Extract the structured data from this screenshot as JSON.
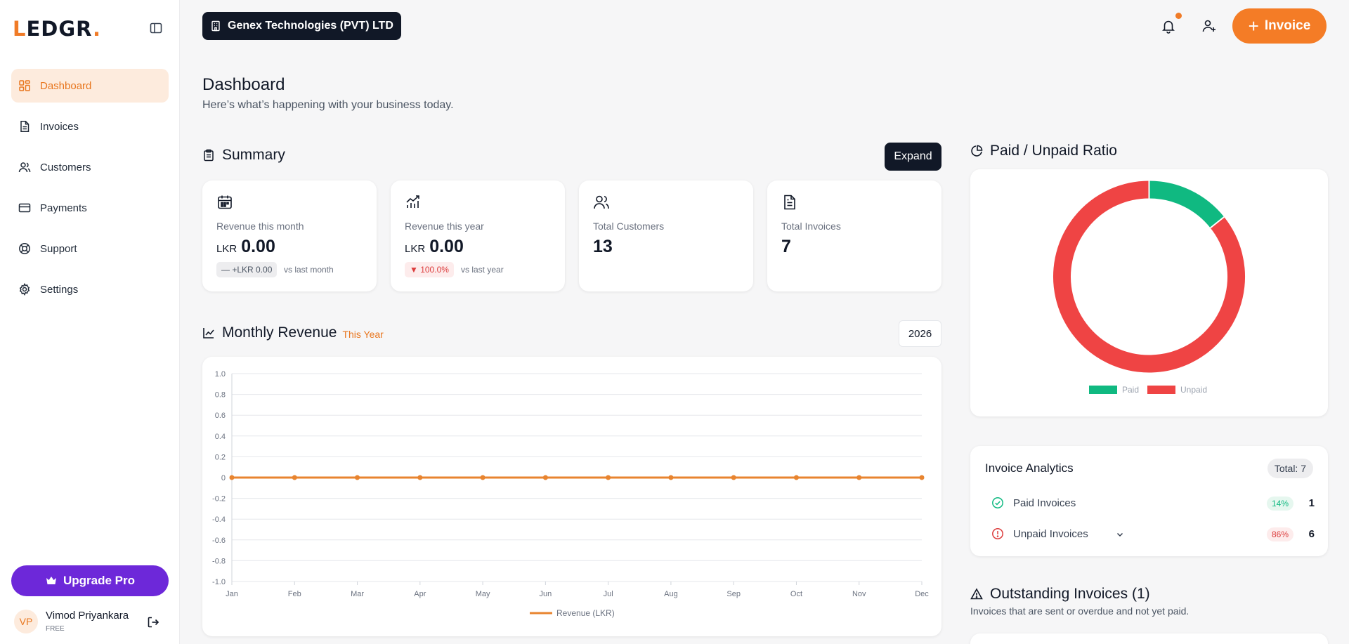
{
  "app": {
    "logo": "LEDGR.",
    "logo_first": "L",
    "logo_mid": "EDGR",
    "logo_dot": "."
  },
  "sidebar": {
    "items": [
      {
        "label": "Dashboard",
        "icon": "dashboard-icon",
        "active": true
      },
      {
        "label": "Invoices",
        "icon": "file-text-icon"
      },
      {
        "label": "Customers",
        "icon": "users-icon"
      },
      {
        "label": "Payments",
        "icon": "credit-card-icon"
      },
      {
        "label": "Support",
        "icon": "life-buoy-icon"
      },
      {
        "label": "Settings",
        "icon": "gear-icon"
      }
    ],
    "upgrade_label": "Upgrade Pro",
    "user": {
      "initials": "VP",
      "name": "Vimod Priyankara",
      "plan": "FREE"
    }
  },
  "header": {
    "company": "Genex Technologies (PVT) LTD",
    "new_invoice_label": "Invoice",
    "new_invoice_plus": "+"
  },
  "page": {
    "title": "Dashboard",
    "subtitle": "Here’s what’s happening with your business today."
  },
  "summary": {
    "title": "Summary",
    "expand_label": "Expand",
    "cards": [
      {
        "label": "Revenue this month",
        "currency": "LKR",
        "value": "0.00",
        "delta": "— +LKR 0.00",
        "compare": "vs last month",
        "icon": "calendar-icon"
      },
      {
        "label": "Revenue this year",
        "currency": "LKR",
        "value": "0.00",
        "delta": "▼ 100.0%",
        "compare": "vs last year",
        "icon": "bar-trend-icon"
      },
      {
        "label": "Total Customers",
        "value": "13",
        "icon": "users-icon"
      },
      {
        "label": "Total Invoices",
        "value": "7",
        "icon": "file-text-icon"
      }
    ]
  },
  "revenue": {
    "title": "Monthly Revenue",
    "tag": "This Year",
    "year": "2026"
  },
  "ratio": {
    "title": "Paid / Unpaid Ratio",
    "legend": [
      "Paid",
      "Unpaid"
    ]
  },
  "analytics": {
    "title": "Invoice Analytics",
    "total": "Total: 7",
    "rows": [
      {
        "label": "Paid Invoices",
        "pct": "14%",
        "count": "1"
      },
      {
        "label": "Unpaid Invoices",
        "pct": "86%",
        "count": "6"
      }
    ]
  },
  "outstanding": {
    "title": "Outstanding Invoices (1)",
    "subtitle": "Invoices that are sent or overdue and not yet paid."
  },
  "colors": {
    "accent": "#f47c26",
    "dark": "#111827",
    "purple": "#6d28d9",
    "paid": "#10b981",
    "unpaid": "#ef4444"
  },
  "chart_data": [
    {
      "type": "line",
      "title": "",
      "x": [
        "Jan",
        "Feb",
        "Mar",
        "Apr",
        "May",
        "Jun",
        "Jul",
        "Aug",
        "Sep",
        "Oct",
        "Nov",
        "Dec"
      ],
      "series": [
        {
          "name": "Revenue (LKR)",
          "values": [
            0,
            0,
            0,
            0,
            0,
            0,
            0,
            0,
            0,
            0,
            0,
            0
          ],
          "color": "#e8842f"
        }
      ],
      "ylim": [
        -1.0,
        1.0
      ],
      "yticks": [
        "1.0",
        "0.8",
        "0.6",
        "0.4",
        "0.2",
        "0",
        "-0.2",
        "-0.4",
        "-0.6",
        "-0.8",
        "-1.0"
      ],
      "grid": true,
      "legend": "bottom"
    },
    {
      "type": "pie",
      "donut": true,
      "categories": [
        "Paid",
        "Unpaid"
      ],
      "values": [
        1,
        6
      ],
      "colors": [
        "#10b981",
        "#ef4444"
      ],
      "legend": "bottom"
    }
  ]
}
